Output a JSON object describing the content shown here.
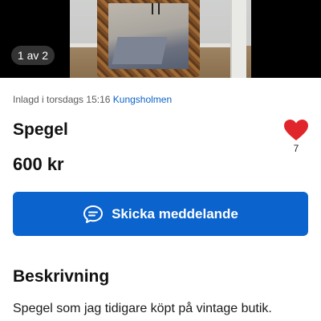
{
  "gallery": {
    "counter": "1 av 2"
  },
  "listing": {
    "posted_prefix": "Inlagd i torsdags 15:16",
    "location": "Kungsholmen",
    "title": "Spegel",
    "price": "600 kr",
    "favorites_count": "7"
  },
  "actions": {
    "message_label": "Skicka meddelande"
  },
  "description": {
    "heading": "Beskrivning",
    "text": "Spegel som jag tidigare köpt på vintage butik."
  },
  "colors": {
    "accent": "#0b63ce",
    "heart": "#e0262b",
    "location_link": "#0e63c9"
  },
  "icons": {
    "favorite": "heart-icon",
    "message": "chat-bubble-icon"
  }
}
